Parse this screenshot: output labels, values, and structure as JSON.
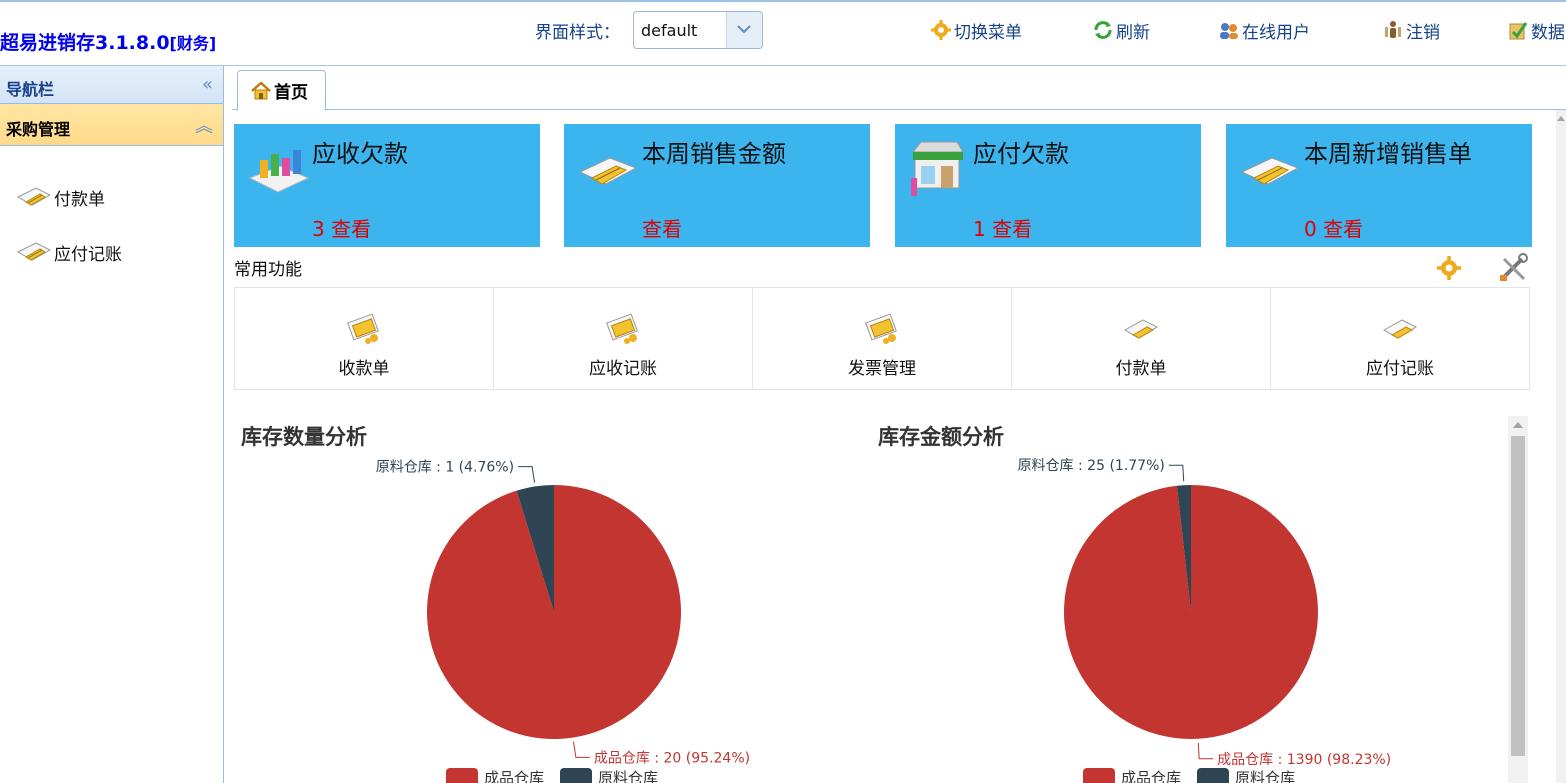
{
  "app": {
    "title": "超易进销存3.1.8.0",
    "subtitle": "[财务]"
  },
  "header": {
    "style_label": "界面样式：",
    "style_value": "default",
    "buttons": [
      {
        "label": "切换菜单",
        "icon": "gear-icon"
      },
      {
        "label": "刷新",
        "icon": "refresh-icon"
      },
      {
        "label": "在线用户",
        "icon": "users-icon"
      },
      {
        "label": "注销",
        "icon": "logout-icon"
      },
      {
        "label": "数据",
        "icon": "data-icon"
      }
    ]
  },
  "sidebar": {
    "title": "导航栏",
    "group": "采购管理",
    "items": [
      {
        "label": "付款单",
        "icon": "payment-slip-icon"
      },
      {
        "label": "应付记账",
        "icon": "payable-ledger-icon"
      }
    ]
  },
  "tabs": [
    {
      "label": "首页",
      "icon": "home-icon"
    }
  ],
  "cards": [
    {
      "title": "应收欠款",
      "count": "3 查看",
      "icon": "receivable-icon"
    },
    {
      "title": "本周销售金额",
      "count": "查看",
      "icon": "sales-amount-icon"
    },
    {
      "title": "应付欠款",
      "count": "1 查看",
      "icon": "store-icon"
    },
    {
      "title": "本周新增销售单",
      "count": "0 查看",
      "icon": "new-order-icon"
    }
  ],
  "common": {
    "label": "常用功能",
    "items": [
      {
        "label": "收款单",
        "icon": "receipt-icon"
      },
      {
        "label": "应收记账",
        "icon": "receivable-ledger-icon"
      },
      {
        "label": "发票管理",
        "icon": "invoice-icon"
      },
      {
        "label": "付款单",
        "icon": "payment-slip-icon"
      },
      {
        "label": "应付记账",
        "icon": "payable-ledger-icon"
      }
    ]
  },
  "colors": {
    "slice_main": "#c23531",
    "slice_minor": "#2f4554",
    "card_bg": "#3cb4ed",
    "title_blue": "#0000ee"
  },
  "chart_data": [
    {
      "type": "pie",
      "title": "库存数量分析",
      "slices": [
        {
          "name": "成品仓库",
          "value": 20,
          "percent": 95.24,
          "label": "成品仓库 : 20 (95.24%)"
        },
        {
          "name": "原料仓库",
          "value": 1,
          "percent": 4.76,
          "label": "原料仓库 : 1 (4.76%)"
        }
      ],
      "legend": [
        "成品仓库",
        "原料仓库"
      ],
      "legend_position": "bottom-center"
    },
    {
      "type": "pie",
      "title": "库存金额分析",
      "slices": [
        {
          "name": "成品仓库",
          "value": 1390,
          "percent": 98.23,
          "label": "成品仓库 : 1390 (98.23%)"
        },
        {
          "name": "原料仓库",
          "value": 25,
          "percent": 1.77,
          "label": "原料仓库 : 25 (1.77%)"
        }
      ],
      "legend": [
        "成品仓库",
        "原料仓库"
      ],
      "legend_position": "bottom-center"
    }
  ]
}
